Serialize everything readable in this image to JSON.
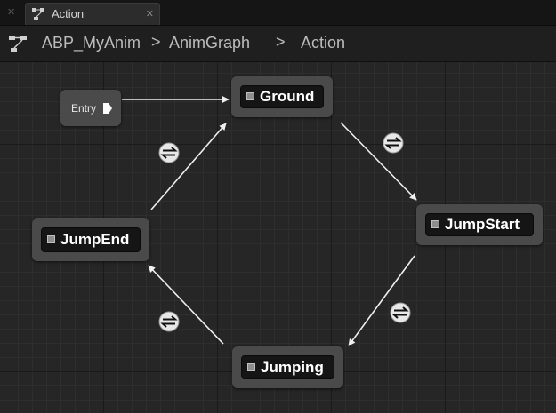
{
  "tab": {
    "label": "Action",
    "icon": "state-machine-icon"
  },
  "breadcrumb": {
    "items": [
      "ABP_MyAnim",
      "AnimGraph",
      "Action"
    ],
    "separator": ">"
  },
  "graph": {
    "entry_label": "Entry",
    "states": {
      "ground": "Ground",
      "jumpstart": "JumpStart",
      "jumping": "Jumping",
      "jumpend": "JumpEnd"
    },
    "transition_icon": "transition-rule-icon"
  },
  "colors": {
    "graph_bg": "#262626",
    "node_frame": "#4a4a4a",
    "node_body": "#151515",
    "wire": "#f0f0f0"
  }
}
